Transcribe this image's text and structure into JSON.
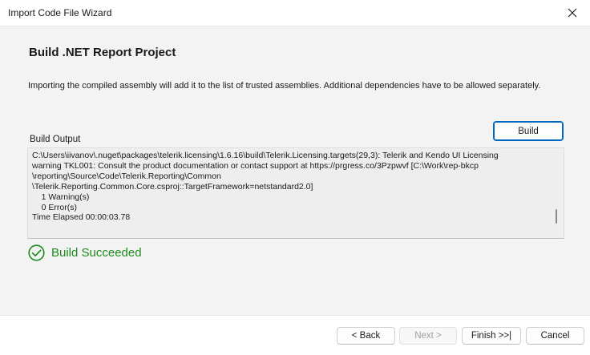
{
  "window": {
    "title": "Import Code File Wizard",
    "close_icon": "close-icon"
  },
  "page": {
    "heading": "Build .NET Report Project",
    "description": "Importing the compiled assembly will add it to the list of trusted assemblies. Additional dependencies have to be allowed separately."
  },
  "build": {
    "output_label": "Build Output",
    "button_label": "Build",
    "output_lines": [
      "C:\\Users\\iivanov\\.nuget\\packages\\telerik.licensing\\1.6.16\\build\\Telerik.Licensing.targets(29,3): Telerik and Kendo UI Licensing",
      "warning TKL001: Consult the product documentation or contact support at https://prgress.co/3Pzpwvf [C:\\Work\\rep-bkcp",
      "\\reporting\\Source\\Code\\Telerik.Reporting\\Common",
      "\\Telerik.Reporting.Common.Core.csproj::TargetFramework=netstandard2.0]",
      "    1 Warning(s)",
      "    0 Error(s)",
      "Time Elapsed 00:00:03.78"
    ],
    "status_text": "Build Succeeded",
    "status_icon": "check-circle-icon",
    "status_color": "#1e8a1e"
  },
  "footer": {
    "back_label": "< Back",
    "next_label": "Next >",
    "finish_label": "Finish >>|",
    "cancel_label": "Cancel"
  },
  "colors": {
    "accent": "#0067c0",
    "content_bg": "#f3f3f3"
  }
}
